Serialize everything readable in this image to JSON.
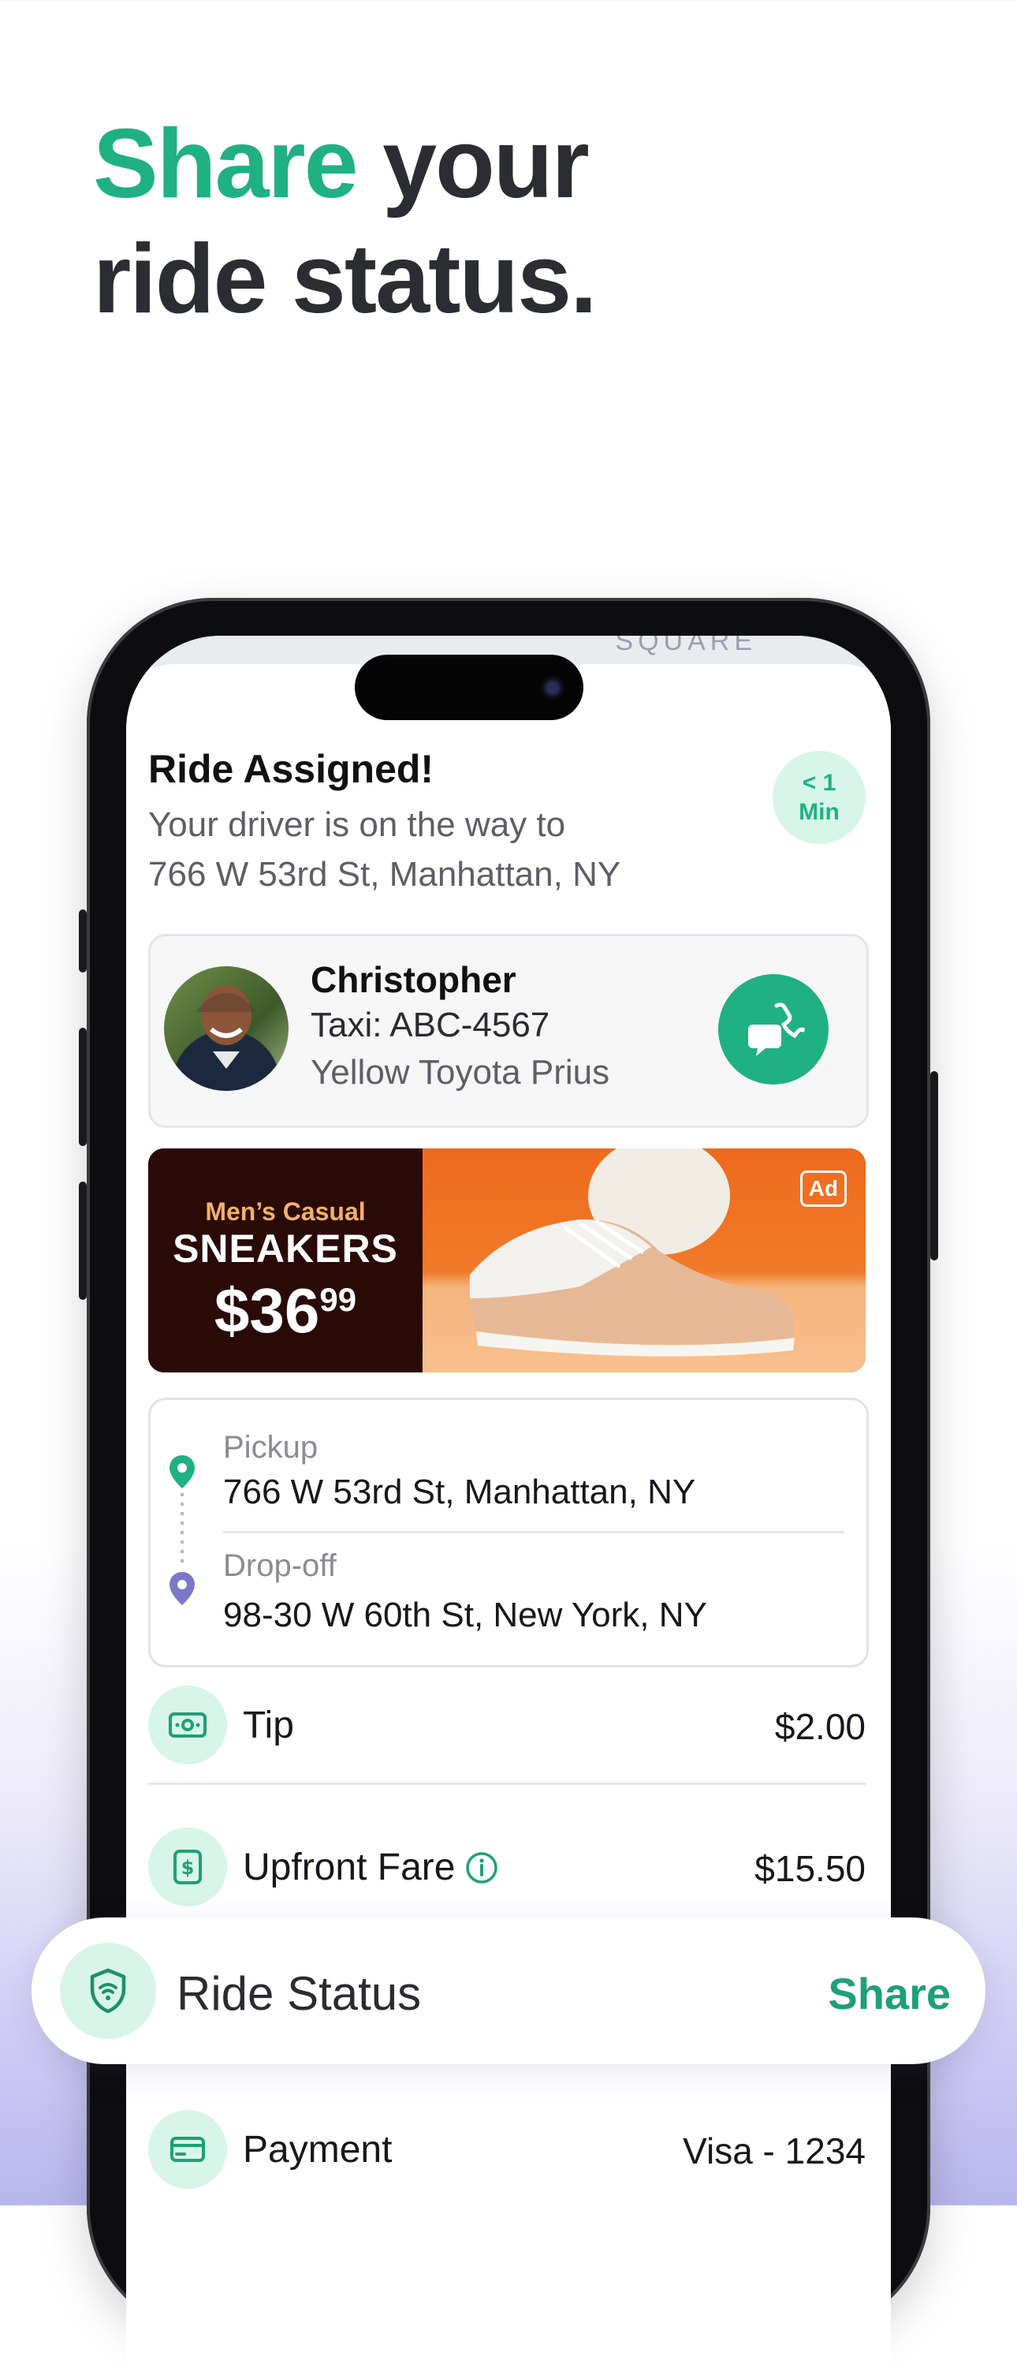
{
  "headline": {
    "accent": "Share",
    "rest_line1": " your",
    "line2": "ride status."
  },
  "map": {
    "label": "SQUARE"
  },
  "ride": {
    "title": "Ride Assigned!",
    "subtitle_line1": "Your driver is on the way to",
    "subtitle_line2": "766 W 53rd St, Manhattan, NY",
    "eta_line1": "< 1",
    "eta_line2": "Min"
  },
  "driver": {
    "name": "Christopher",
    "taxi": "Taxi: ABC-4567",
    "car": "Yellow Toyota Prius",
    "avatar_icon": "driver-avatar",
    "call_icon": "chat-phone-icon"
  },
  "ad": {
    "kicker": "Men’s Casual",
    "title": "SNEAKERS",
    "price_main": "$36",
    "price_cents": "99",
    "badge": "Ad"
  },
  "route": {
    "pickup_label": "Pickup",
    "pickup_address": "766 W 53rd St, Manhattan, NY",
    "dropoff_label": "Drop-off",
    "dropoff_address": "98-30 W 60th St, New York, NY"
  },
  "rows": {
    "tip": {
      "label": "Tip",
      "value": "$2.00",
      "icon": "cash-icon"
    },
    "fare": {
      "label": "Upfront Fare",
      "value": "$15.50",
      "icon": "dollar-icon",
      "info_icon": "info-icon"
    },
    "payment": {
      "label": "Payment",
      "value": "Visa - 1234",
      "icon": "card-icon"
    }
  },
  "status_bar": {
    "label": "Ride Status",
    "action": "Share",
    "icon": "shield-wifi-icon"
  },
  "colors": {
    "accent": "#1fb182",
    "accent_light": "#d8f5ea",
    "text": "#2b2b31",
    "dropoff_pin": "#7a78c8"
  }
}
